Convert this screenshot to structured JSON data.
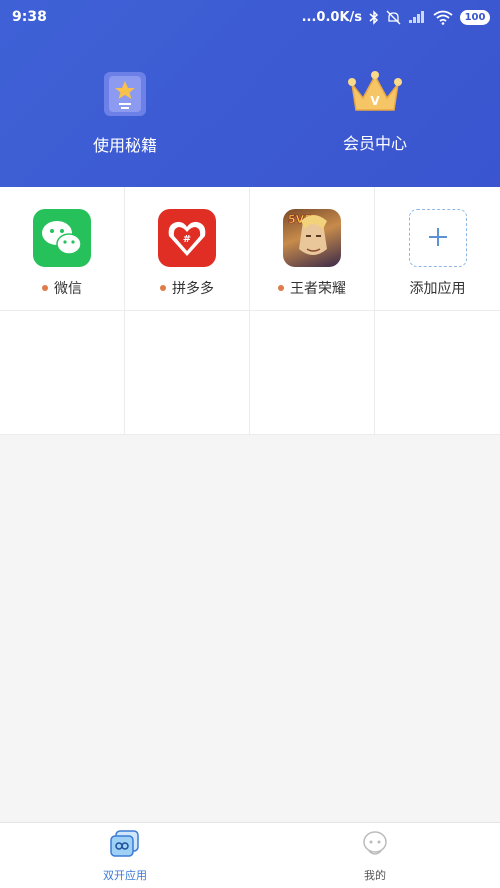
{
  "status_bar": {
    "time": "9:38",
    "network_speed": "...0.0K/s",
    "battery": "100"
  },
  "header": {
    "actions": [
      {
        "label": "使用秘籍",
        "icon": "book-star-icon"
      },
      {
        "label": "会员中心",
        "icon": "crown-icon"
      }
    ],
    "colors": {
      "background": "#3f5dd4"
    }
  },
  "apps": [
    {
      "label": "微信",
      "icon": "wechat-icon",
      "color": "#27c15b"
    },
    {
      "label": "拼多多",
      "icon": "pinduoduo-icon",
      "color": "#e02e24"
    },
    {
      "label": "王者荣耀",
      "icon": "honor-of-kings-icon"
    },
    {
      "label": "添加应用",
      "icon": "plus-icon"
    }
  ],
  "bottom_nav": [
    {
      "label": "双开应用",
      "icon": "dual-apps-icon",
      "active": true
    },
    {
      "label": "我的",
      "icon": "profile-icon",
      "active": false
    }
  ],
  "colors": {
    "accent": "#3a7bd5",
    "dot": "#e07a48"
  }
}
